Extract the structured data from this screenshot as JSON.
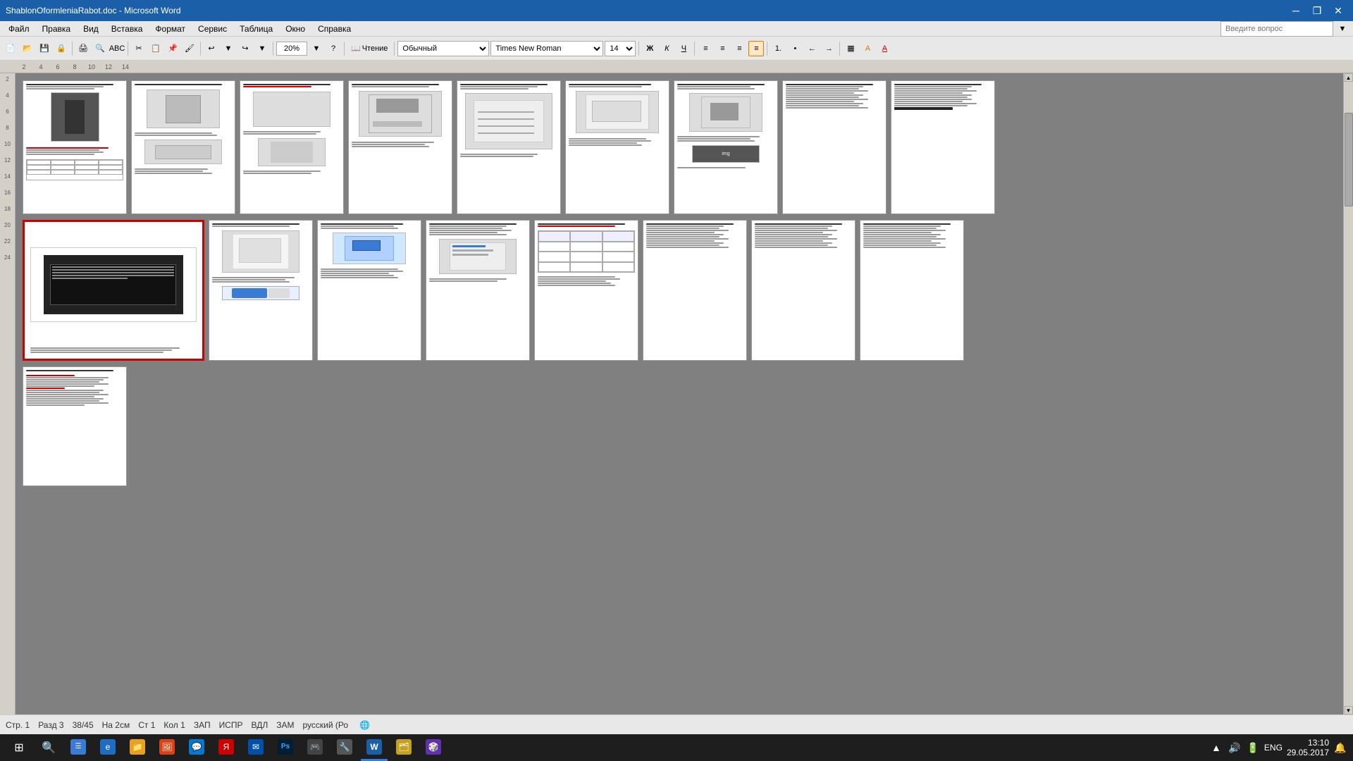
{
  "window": {
    "title": "ShablonOformleniaRabot.doc - Microsoft Word",
    "min_label": "─",
    "restore_label": "❐",
    "close_label": "✕"
  },
  "menu": {
    "items": [
      "Файл",
      "Правка",
      "Вид",
      "Вставка",
      "Формат",
      "Сервис",
      "Таблица",
      "Окно",
      "Справка"
    ]
  },
  "toolbar": {
    "zoom_value": "20%",
    "reading_label": "Чтение",
    "style_value": "Обычный",
    "font_value": "Times New Roman",
    "size_value": "14",
    "question_placeholder": "Введите вопрос",
    "bold": "Ж",
    "italic": "К",
    "underline": "Ч"
  },
  "ruler": {
    "numbers": [
      "2",
      "4",
      "6",
      "8",
      "10",
      "12",
      "14"
    ]
  },
  "status_bar": {
    "page": "Стр. 1",
    "section": "Разд 3",
    "pages": "38/45",
    "margin": "На 2см",
    "col": "Ст 1",
    "col2": "Кол 1",
    "zap": "ЗАП",
    "ispr": "ИСПР",
    "vdl": "ВДЛ",
    "zam": "ЗАМ",
    "lang": "русский (Ро"
  },
  "taskbar": {
    "time": "13:10",
    "date": "29.05.2017",
    "lang": "ENG",
    "apps": [
      "⊞",
      "🔍",
      "☰",
      "🌐",
      "📁",
      "🖼",
      "💬",
      "🦊",
      "🎨",
      "💻",
      "🔧",
      "W",
      "🗂",
      "🎮"
    ]
  },
  "pages": {
    "row1_count": 9,
    "row2_count": 8,
    "row3_count": 1,
    "selected_page": 9
  },
  "colors": {
    "accent": "#1a5fa8",
    "selected_border": "#cc0000",
    "toolbar_bg": "#e8e8e8",
    "doc_bg": "#808080",
    "taskbar_bg": "#1e1e1e"
  }
}
